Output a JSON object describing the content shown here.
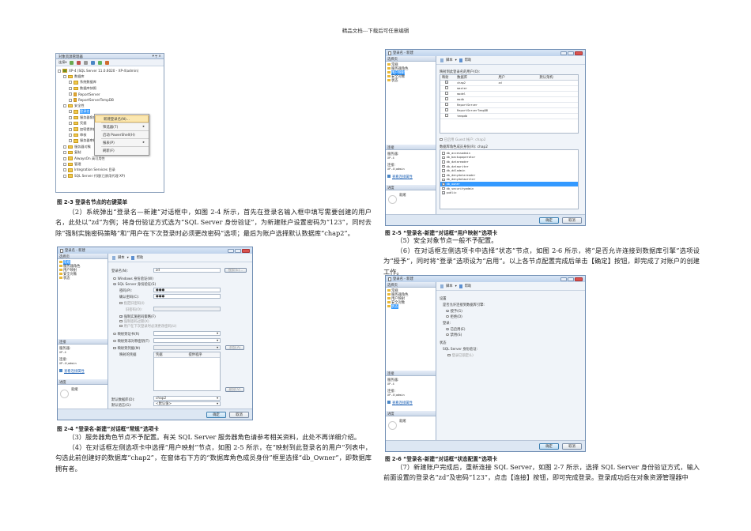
{
  "page_header": "精品文档---下载后可任意编辑",
  "fig23": {
    "title": "对象资源管理器",
    "title_buttons": "▾ ╤ ×",
    "connect": "连接▾",
    "tree": [
      {
        "label": "XP-4 (SQL Server 11.0.6020 - XP-4\\admin)",
        "depth": 0,
        "icon": "server-icon"
      },
      {
        "label": "数据库",
        "depth": 1,
        "icon": "folder-icon"
      },
      {
        "label": "系统数据库",
        "depth": 2,
        "icon": "folder-icon"
      },
      {
        "label": "数据库快照",
        "depth": 2,
        "icon": "folder-icon"
      },
      {
        "label": "ReportServer",
        "depth": 2,
        "icon": "database-icon"
      },
      {
        "label": "ReportServerTempDB",
        "depth": 2,
        "icon": "database-icon"
      },
      {
        "label": "安全性",
        "depth": 1,
        "icon": "folder-icon"
      },
      {
        "label": "登录名",
        "depth": 2,
        "icon": "folder-icon",
        "selected": true
      },
      {
        "label": "服务器角色",
        "depth": 2,
        "icon": "folder-icon"
      },
      {
        "label": "凭据",
        "depth": 2,
        "icon": "folder-icon"
      },
      {
        "label": "加密提供程序",
        "depth": 2,
        "icon": "folder-icon"
      },
      {
        "label": "审核",
        "depth": 2,
        "icon": "folder-icon"
      },
      {
        "label": "服务器审核规范",
        "depth": 2,
        "icon": "folder-icon"
      },
      {
        "label": "服务器对象",
        "depth": 1,
        "icon": "folder-icon"
      },
      {
        "label": "复制",
        "depth": 1,
        "icon": "folder-icon"
      },
      {
        "label": "AlwaysOn 高可用性",
        "depth": 1,
        "icon": "folder-icon"
      },
      {
        "label": "管理",
        "depth": 1,
        "icon": "folder-icon"
      },
      {
        "label": "Integration Services 目录",
        "depth": 1,
        "icon": "folder-icon"
      },
      {
        "label": "SQL Server 代理(已禁用代理 XP)",
        "depth": 1,
        "icon": "agent-icon"
      }
    ],
    "context_menu": [
      {
        "label": "新建登录名(N)...",
        "highlight": true
      },
      {
        "label": "筛选器(T)",
        "submenu": true
      },
      {
        "label": "启动 PowerShell(H)"
      },
      {
        "label": "报表(P)",
        "submenu": true
      },
      {
        "label": "刷新(F)"
      }
    ],
    "caption": "图 2-3  登录名节点的右键菜单"
  },
  "para_2": "（2）系统弹出“登录名—新建”对话框中，如图 2-4 所示，首先在登录名输入框中填写需要创建的用户名，此处以“zd”为例；将身份验证方式选为“SQL Server 身份验证”，为新建账户设置密码为“123”，同时去除“强制实施密码策略”和“用户在下次登录时必须更改密码”选项；最后为账户选择默认数据库“chap2”。",
  "dialog_common": {
    "title": "登录名 - 新建",
    "select_page": "选择页",
    "pages": [
      "常规",
      "服务器角色",
      "用户映射",
      "安全对象",
      "状态"
    ],
    "script": "脚本",
    "script_arrow": "▾",
    "help": "帮助",
    "connection_header": "连接",
    "server_label": "服务器:",
    "server": "XP-4",
    "connection_label": "连接:",
    "connection": "XP-4\\admin",
    "view_properties": "查看连接属性",
    "progress_header": "进度",
    "ready": "就绪",
    "ok": "确定",
    "cancel": "取消"
  },
  "fig24": {
    "login_name_label": "登录名(N):",
    "login_name": "zd",
    "search": "搜索(E)...",
    "windows_auth": "Windows 身份验证(W)",
    "sql_auth": "SQL Server 身份验证(S)",
    "password_label": "密码(P):",
    "password": "●●●",
    "confirm_label": "确认密码(C):",
    "confirm": "●●●",
    "specify_old": "指定旧密码(I)",
    "old_password_label": "旧密码(O):",
    "enforce_policy": "强制实施密码策略(F)",
    "enforce_expiry": "强制密码过期(X)",
    "must_change": "用户在下次登录时必须更改密码(U)",
    "map_cert": "映射到证书(R)",
    "map_asym": "映射到非对称密钥(T)",
    "map_cred": "映射到凭据(M)",
    "add": "添加(A)",
    "mapped_creds": "映射的凭据",
    "cred_columns": [
      "凭据",
      "提供程序"
    ],
    "remove": "删除(V)",
    "default_db_label": "默认数据库(D):",
    "default_db": "chap2",
    "default_lang_label": "默认语言(G):",
    "default_lang": "<默认值>",
    "caption": "图 2-4 “登录名-新建”对话框“常规”选项卡"
  },
  "para_3": "（3）服务器角色节点不予配置。有关 SQL Server 服务器角色请参考相关资料，此处不再详细介绍。",
  "para_4": "（4）在对话框左侧选项卡中选择“用户映射”节点，如图 2-5 所示，在“映射到此登录名的用户”列表中，勾选此前创建好的数据库“chap2”，在窗体右下方的“数据库角色成员身份”框里选择“db_Owner”，即数据库拥有者。",
  "fig25": {
    "users_label": "映射到此登录名的用户(O):",
    "columns": [
      "映射",
      "数据库",
      "用户",
      "默认架构"
    ],
    "rows": [
      {
        "checked": true,
        "db": "chap2",
        "user": "zd",
        "schema": ""
      },
      {
        "checked": false,
        "db": "master",
        "user": "",
        "schema": ""
      },
      {
        "checked": false,
        "db": "model",
        "user": "",
        "schema": ""
      },
      {
        "checked": false,
        "db": "msdb",
        "user": "",
        "schema": ""
      },
      {
        "checked": false,
        "db": "ReportServer",
        "user": "",
        "schema": ""
      },
      {
        "checked": false,
        "db": "ReportServerTempDB",
        "user": "",
        "schema": ""
      },
      {
        "checked": false,
        "db": "tempdb",
        "user": "",
        "schema": ""
      }
    ],
    "guest": "已启用 Guest 帐户: chap2",
    "roles_label": "数据库角色成员身份(R): chap2",
    "roles": [
      {
        "name": "db_accessadmin",
        "checked": false
      },
      {
        "name": "db_backupoperator",
        "checked": false
      },
      {
        "name": "db_datareader",
        "checked": false
      },
      {
        "name": "db_datawriter",
        "checked": false
      },
      {
        "name": "db_ddladmin",
        "checked": false
      },
      {
        "name": "db_denydatareader",
        "checked": false
      },
      {
        "name": "db_denydatawriter",
        "checked": false
      },
      {
        "name": "db_owner",
        "checked": true,
        "selected": true
      },
      {
        "name": "db_securityadmin",
        "checked": false
      },
      {
        "name": "public",
        "checked": true
      }
    ],
    "caption": "图 2-5 “登录名-新建”对话框“用户映射”选项卡"
  },
  "para_5": "（5）安全对象节点一般不予配置。",
  "para_6": "（6）在对话框左侧选项卡中选择“状态”节点，如图 2-6 所示，将“是否允许连接到数据库引擎”选项设为“授予”，同时将“登录”选项设为“启用”。以上各节点配置完成后单击【确定】按钮，即完成了对账户的创建工作。",
  "fig26": {
    "settings": "设置",
    "permission_label": "是否允许连接到数据库引擎:",
    "grant": "授予(G)",
    "deny": "拒绝(D)",
    "login_label": "登录:",
    "enabled": "已启用(E)",
    "disabled": "禁用(S)",
    "status": "状态",
    "sql_auth_label": "SQL Server 身份验证:",
    "locked": "登录已锁定(L)",
    "caption": "图 2-6 “登录名-新建”对话框“状态配置”选项卡"
  },
  "para_7": "（7）新建账户完成后，重新连接 SQL Server，如图 2-7 所示，选择 SQL Server 身份验证方式，输入前面设置的登录名“zd”及密码“123”，点击【连接】按钮，即可完成登录。登录成功后在对象资源管理器中"
}
